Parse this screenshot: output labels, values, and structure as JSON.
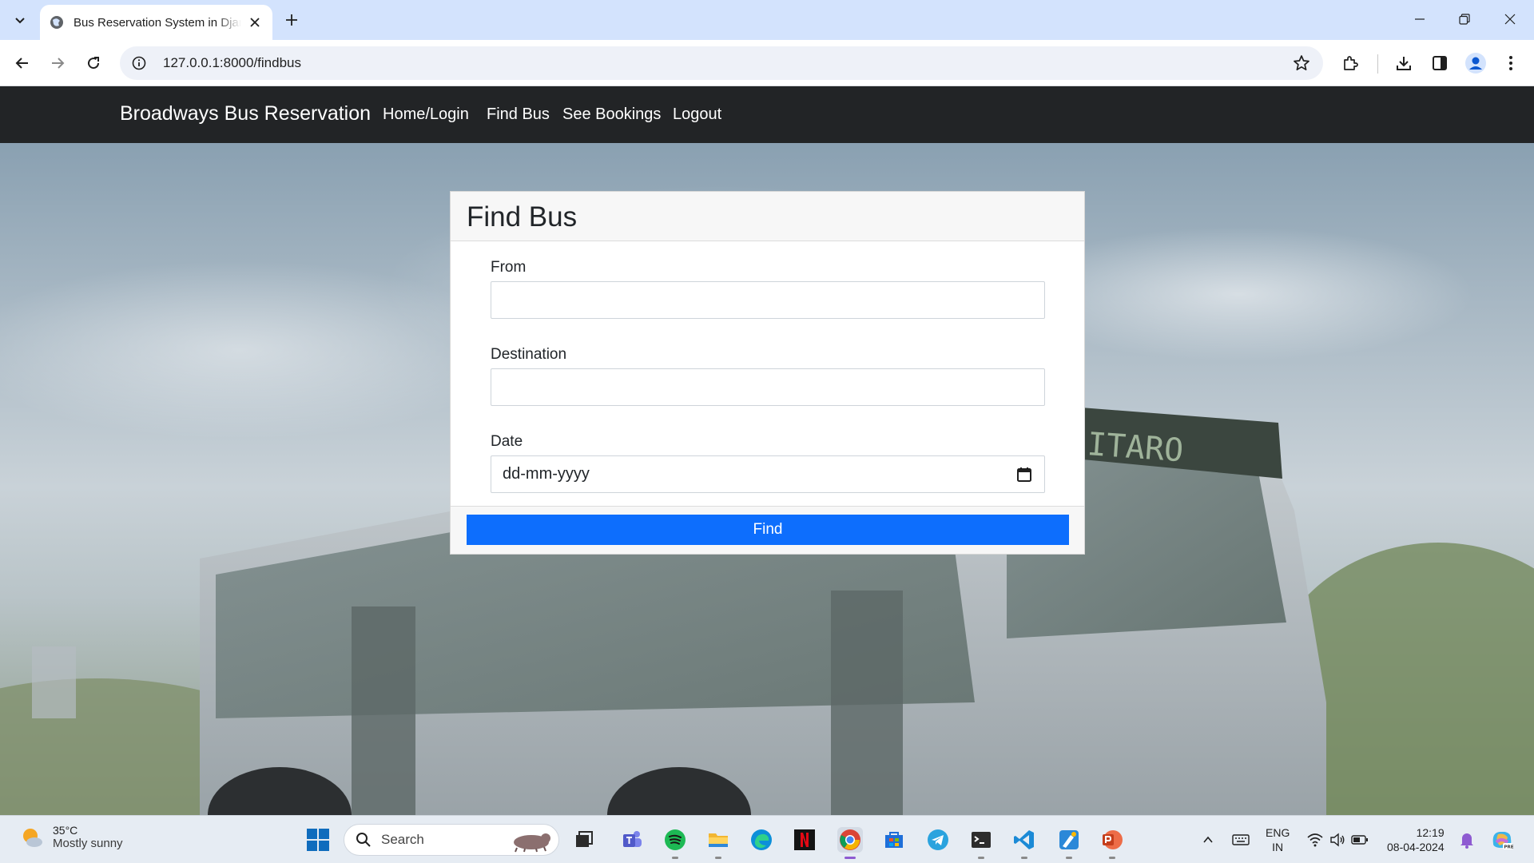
{
  "browser": {
    "tab_title": "Bus Reservation System in Django",
    "url": "127.0.0.1:8000/findbus"
  },
  "navbar": {
    "brand": "Broadways Bus Reservation",
    "links": [
      "Home/Login",
      "Find Bus",
      "See Bookings",
      "Logout"
    ]
  },
  "form": {
    "title": "Find Bus",
    "from_label": "From",
    "from_value": "",
    "destination_label": "Destination",
    "destination_value": "",
    "date_label": "Date",
    "date_placeholder": "dd-mm-yyyy",
    "submit_label": "Find"
  },
  "taskbar": {
    "weather_temp": "35°C",
    "weather_desc": "Mostly sunny",
    "search_placeholder": "Search",
    "lang_top": "ENG",
    "lang_bottom": "IN",
    "time": "12:19",
    "date": "08-04-2024"
  },
  "colors": {
    "primary_button": "#0d6efd",
    "navbar_bg": "#222426",
    "tabstrip_bg": "#d3e3fd"
  }
}
